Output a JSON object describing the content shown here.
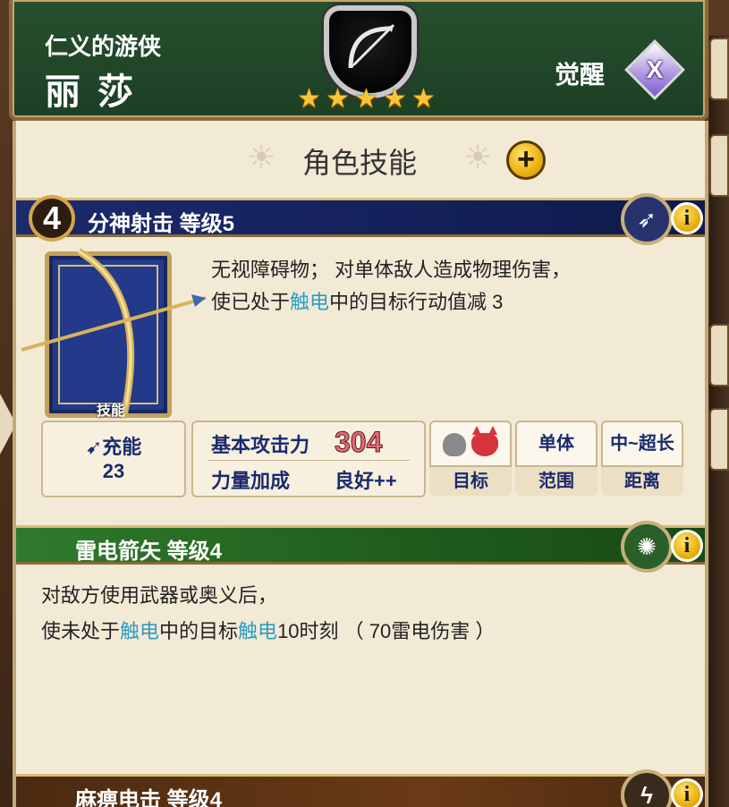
{
  "header": {
    "title": "仁义的游侠",
    "name": "丽 莎",
    "stars": [
      "★",
      "★",
      "★",
      "★",
      "★"
    ],
    "awaken_label": "觉醒",
    "awaken_badge": "X",
    "star_count": 5
  },
  "panel": {
    "section_title": "角色技能",
    "plus_label": "+"
  },
  "skills": [
    {
      "number": "4",
      "title": "分神射击 等级5",
      "desc_line1": "无视障碍物； 对单体敌人造成物理伤害，",
      "desc_line2_a": "使已处于",
      "desc_line2_hl": "触电",
      "desc_line2_b": "中的目标行动值减 3",
      "card_label": "技能",
      "charge_label": "充能",
      "charge_value": "23",
      "stats": {
        "atk_label": "基本攻击力",
        "atk_value": "304",
        "bonus_label": "力量加成",
        "bonus_value": "良好++"
      },
      "chips": [
        {
          "top": "",
          "bottom": "目标"
        },
        {
          "top": "单体",
          "bottom": "范围"
        },
        {
          "top": "中~超长",
          "bottom": "距离"
        }
      ],
      "info": "i"
    },
    {
      "title": "雷电箭矢 等级4",
      "desc_line1": "对敌方使用武器或奥义后，",
      "desc_line2_a": "使未处于",
      "desc_line2_hl1": "触电",
      "desc_line2_b": "中的目标",
      "desc_line2_hl2": "触电",
      "desc_line2_c": "10时刻 （ 70雷电伤害 ）",
      "info": "i"
    },
    {
      "title": "麻痹电击 等级4",
      "info": "i"
    }
  ],
  "colors": {
    "header_green": "#1d3f24",
    "skill_blue": "#13205a",
    "skill_green": "#1f5b1c",
    "highlight": "#2a9cc6",
    "gold": "#f7c53a"
  }
}
